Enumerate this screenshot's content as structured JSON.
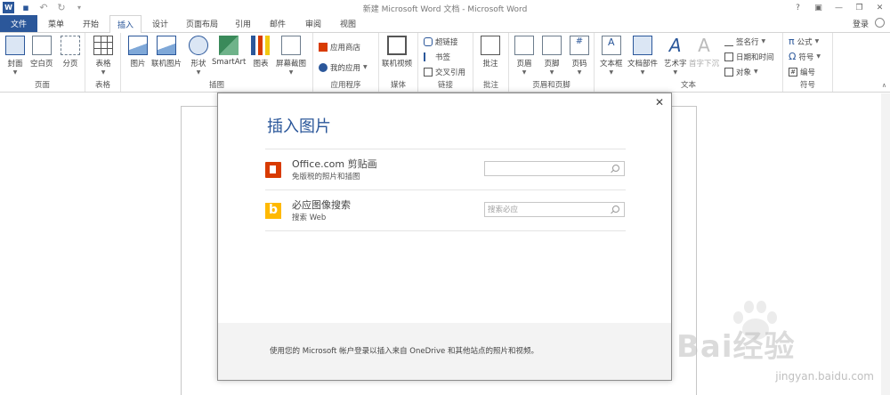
{
  "window": {
    "title": "新建 Microsoft Word 文档 - Microsoft Word",
    "controls": [
      "?",
      "▣",
      "—",
      "❐",
      "✕"
    ]
  },
  "tabs": {
    "file": "文件",
    "items": [
      "菜单",
      "开始",
      "插入",
      "设计",
      "页面布局",
      "引用",
      "邮件",
      "审阅",
      "视图"
    ],
    "active": "插入",
    "login": "登录"
  },
  "ribbon": {
    "groups": {
      "pages": {
        "label": "页面",
        "cover": "封面",
        "blank": "空白页",
        "break": "分页"
      },
      "table": {
        "label": "表格",
        "table": "表格"
      },
      "illustrations": {
        "label": "插图",
        "picture": "图片",
        "online_picture": "联机图片",
        "shapes": "形状",
        "smartart": "SmartArt",
        "chart": "图表",
        "screenshot": "屏幕截图"
      },
      "apps": {
        "label": "应用程序",
        "store": "应用商店",
        "my_apps": "我的应用"
      },
      "media": {
        "label": "媒体",
        "online_video": "联机视频"
      },
      "links": {
        "label": "链接",
        "hyperlink": "超链接",
        "bookmark": "书签",
        "cross_ref": "交叉引用"
      },
      "comments": {
        "label": "批注",
        "comment": "批注"
      },
      "header_footer": {
        "label": "页眉和页脚",
        "header": "页眉",
        "footer": "页脚",
        "page_number": "页码"
      },
      "text": {
        "label": "文本",
        "textbox": "文本框",
        "quick_parts": "文档部件",
        "wordart": "艺术字",
        "drop_cap": "首字下沉",
        "signature": "签名行",
        "datetime": "日期和时间",
        "object": "对象"
      },
      "symbols": {
        "label": "符号",
        "equation": "公式",
        "symbol": "符号",
        "number": "编号"
      }
    }
  },
  "dialog": {
    "title": "插入图片",
    "close": "✕",
    "sources": [
      {
        "name": "Office.com 剪贴画",
        "desc": "免版税的照片和插图",
        "placeholder": ""
      },
      {
        "name": "必应图像搜索",
        "desc": "搜索 Web",
        "placeholder": "搜索必应"
      }
    ],
    "footer": "使用您的 Microsoft 帐户登录以插入来自 OneDrive 和其他站点的照片和视频。"
  },
  "watermark": {
    "brand": "Bai经验",
    "url": "jingyan.baidu.com"
  }
}
